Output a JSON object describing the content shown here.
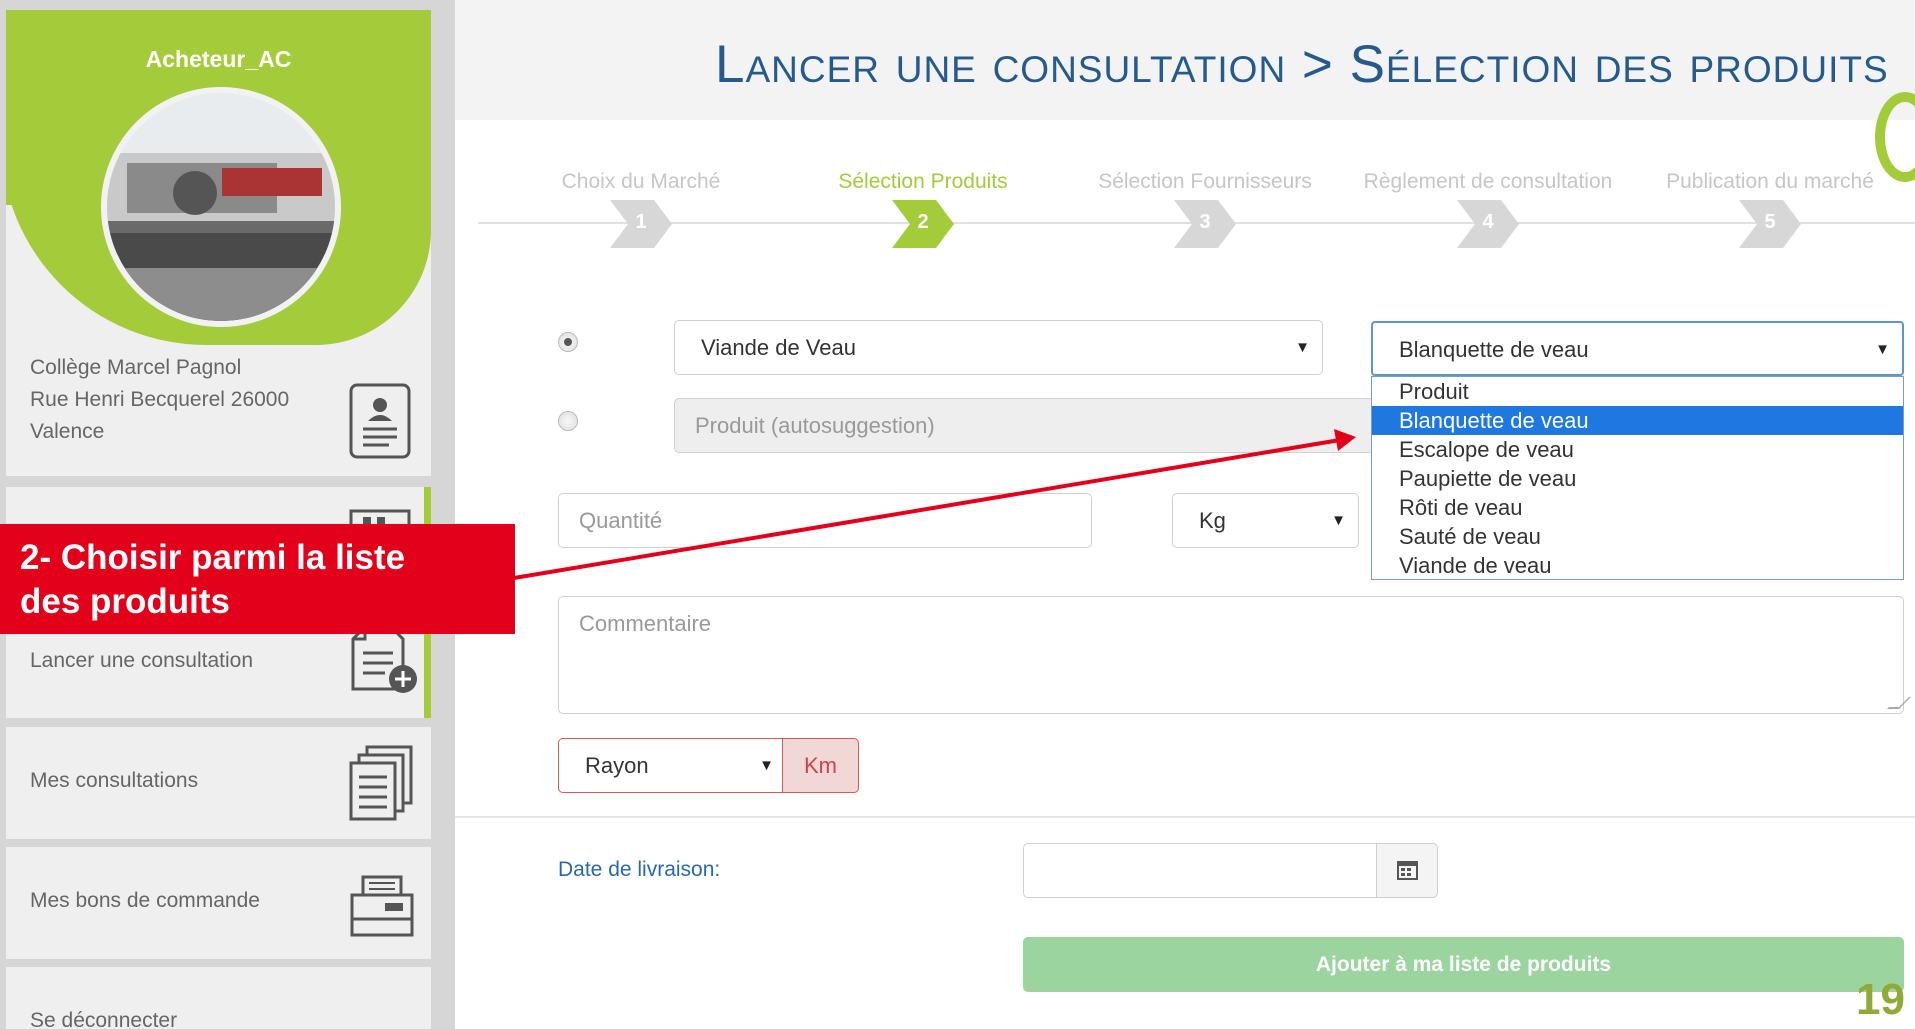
{
  "sidebar": {
    "user_name": "Acheteur_AC",
    "address": [
      "Collège Marcel Pagnol",
      "Rue Henri Becquerel 26000",
      "Valence"
    ],
    "items": [
      {
        "label": "Lancer une consultation"
      },
      {
        "label": "Mes consultations"
      },
      {
        "label": "Mes bons de commande"
      },
      {
        "label": "Se déconnecter"
      }
    ]
  },
  "callout": {
    "line1": "2- Choisir parmi la liste",
    "line2": "des produits"
  },
  "header": {
    "title": "Lancer une consultation > Sélection des produits"
  },
  "steps": [
    {
      "label": "Choix du Marché",
      "num": "1"
    },
    {
      "label": "Sélection Produits",
      "num": "2"
    },
    {
      "label": "Sélection Fournisseurs",
      "num": "3"
    },
    {
      "label": "Règlement de consultation",
      "num": "4"
    },
    {
      "label": "Publication du marché",
      "num": "5"
    }
  ],
  "form": {
    "category_value": "Viande de Veau",
    "product_value": "Blanquette de veau",
    "search_placeholder": "Produit (autosuggestion)",
    "quantity_placeholder": "Quantité",
    "unit_value": "Kg",
    "comment_placeholder": "Commentaire",
    "rayon_value": "Rayon",
    "km_label": "Km",
    "date_label": "Date de livraison:",
    "add_button": "Ajouter à ma liste de produits"
  },
  "dropdown_options": [
    "Produit",
    "Blanquette de veau",
    "Escalope de veau",
    "Paupiette de veau",
    "Rôti de veau",
    "Sauté de veau",
    "Viande de veau"
  ],
  "page_number": "19",
  "colors": {
    "accent_green": "#a4cb3a",
    "title_blue": "#245a8c",
    "callout_red": "#e2001a",
    "selection_blue": "#1e78e0"
  }
}
